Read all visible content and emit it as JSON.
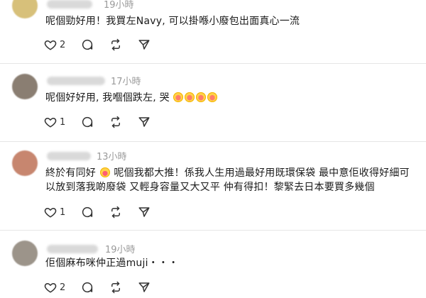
{
  "comments": [
    {
      "time": "19小時",
      "text": "呢個勁好用！我買左Navy, 可以掛喺小廢包出面真心一流",
      "emojis": [],
      "likes": "2",
      "replies": "",
      "reposts": "",
      "avatar_color": "#d7c07a"
    },
    {
      "time": "17小時",
      "text": "呢個好好用, 我嗰個跌左, 哭",
      "emojis": [
        "crying-emoji",
        "crying-emoji",
        "crying-emoji",
        "crying-emoji"
      ],
      "likes": "1",
      "replies": "",
      "reposts": "",
      "avatar_color": "#8a7e72"
    },
    {
      "time": "13小時",
      "text_line1_a": "終於有同好",
      "emoji_mid": "grinning-emoji",
      "text_line1_b": "呢個我都大推！係我人生用過最好用既環保袋 最中意佢收得好細可",
      "text_line2": "以放到落我啲廢袋 又輕身容量又大又平 仲有得扣！黎緊去日本要買多幾個",
      "likes": "1",
      "replies": "",
      "reposts": "",
      "avatar_color": "#c7866f"
    },
    {
      "time": "19小時",
      "text": "佢個麻布咪仲正過muji・・・",
      "emojis": [],
      "likes": "2",
      "replies": "",
      "reposts": "",
      "avatar_color": "#9c948a"
    }
  ],
  "icons": {
    "like": "heart-icon",
    "reply": "comment-bubble-icon",
    "repost": "repost-icon",
    "share": "send-icon"
  }
}
